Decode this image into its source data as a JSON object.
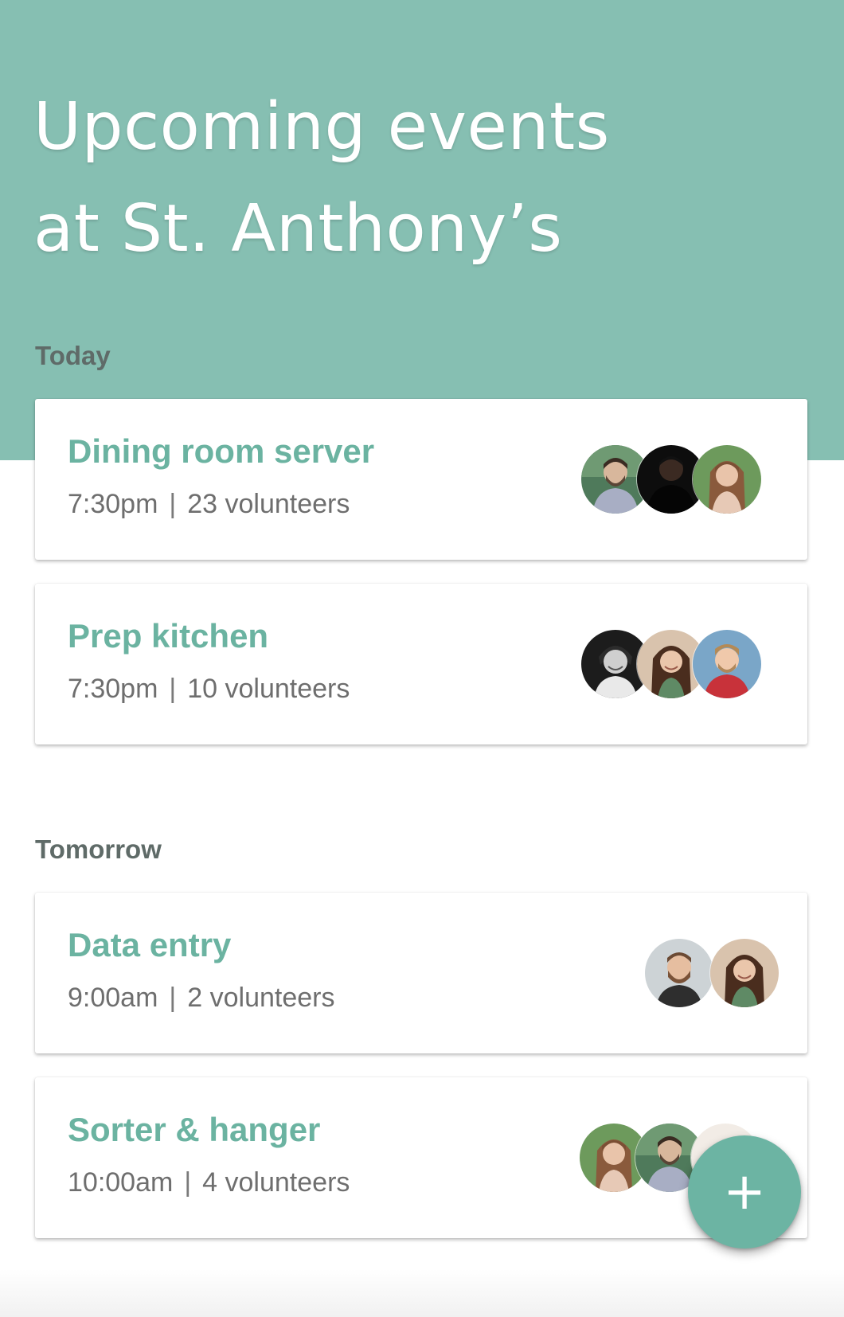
{
  "header": {
    "title_line1": "Upcoming events",
    "title_line2": "at St. Anthony’s",
    "background_color": "#86bfb2"
  },
  "sections": [
    {
      "label": "Today",
      "events": [
        {
          "title": "Dining room server",
          "time": "7:30pm",
          "volunteers": "23 volunteers",
          "avatars": [
            "avatar-man-beard",
            "avatar-man-dark",
            "avatar-woman-long-hair"
          ]
        },
        {
          "title": "Prep kitchen",
          "time": "7:30pm",
          "volunteers": "10 volunteers",
          "avatars": [
            "avatar-man-smiling-bw",
            "avatar-woman-smiling",
            "avatar-man-blond"
          ]
        }
      ]
    },
    {
      "label": "Tomorrow",
      "events": [
        {
          "title": "Data entry",
          "time": "9:00am",
          "volunteers": "2 volunteers",
          "avatars": [
            "avatar-man-bearded-smiling",
            "avatar-woman-smiling"
          ]
        },
        {
          "title": "Sorter & hanger",
          "time": "10:00am",
          "volunteers": "4 volunteers",
          "avatars": [
            "avatar-woman-long-hair",
            "avatar-man-beard",
            "avatar-partial"
          ]
        }
      ]
    }
  ],
  "separator": "|",
  "fab": {
    "icon": "plus-icon",
    "label": "+"
  },
  "colors": {
    "accent": "#6bb3a1",
    "title_text": "#ffffff",
    "meta_text": "#6e6e6e"
  }
}
